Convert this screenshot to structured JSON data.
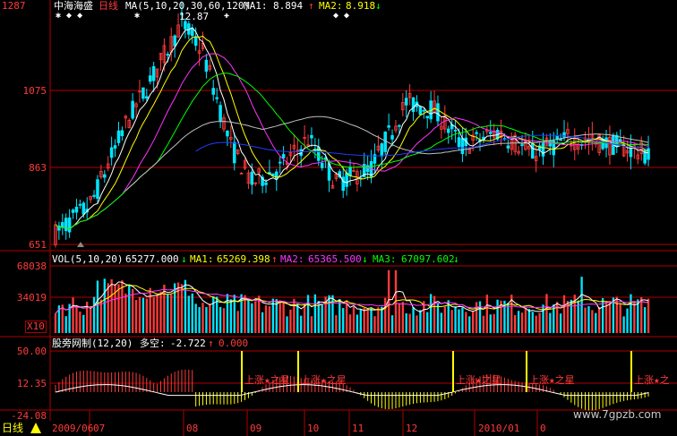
{
  "app": {
    "stock_name": "中海海盛",
    "period": "日线",
    "watermark": "www.7gpzb.com"
  },
  "price_header": {
    "ma_params": "MA(5,10,20,30,60,120)",
    "ma1_label": "MA1:",
    "ma1_value": "8.894",
    "ma2_label": "MA2:",
    "ma2_value": "8.918",
    "high_note": "12.87"
  },
  "price_axis": [
    "1287",
    "1075",
    "863",
    "651"
  ],
  "vol_header": {
    "params": "VOL(5,10,20)",
    "vol_value": "65277.000",
    "ma1_label": "MA1:",
    "ma1_value": "65269.398",
    "ma2_label": "MA2:",
    "ma2_value": "65365.500",
    "ma3_label": "MA3:",
    "ma3_value": "67097.602"
  },
  "vol_axis": [
    "68038",
    "34019",
    "X10"
  ],
  "ind_header": {
    "name": "股旁网制(12,20)",
    "label": "多空:",
    "value1": "-2.722",
    "value2": "0.000"
  },
  "ind_axis": [
    "50.00",
    "12.35",
    "-24.08"
  ],
  "markers": [
    "上涨★之星",
    "上涨★之星",
    "上涨★之星",
    "上涨★之星",
    "上涨★之星",
    "上涨★之"
  ],
  "date_axis": {
    "mode_label": "日线",
    "labels": [
      "2009/06",
      "07",
      "08",
      "09",
      "10",
      "11",
      "12",
      "2010/01",
      "0"
    ]
  },
  "colors": {
    "up": "#ff3b3b",
    "down": "#00e5ff",
    "ma5": "#ffffff",
    "ma10": "#ffff00",
    "ma20": "#ff33ff",
    "ma30": "#00ff00",
    "ma60": "#c0c0c0",
    "ma120": "#1e3cff"
  },
  "chart_data": {
    "type": "line",
    "title": "中海海盛",
    "series": [
      {
        "name": "MA1",
        "values": [
          6.6,
          6.8,
          7.1,
          7.6,
          8.4,
          9.2,
          9.8,
          10.2,
          10.6,
          11.0,
          11.6,
          12.2,
          12.4,
          12.1,
          11.5,
          10.6,
          9.6,
          8.9,
          8.4,
          8.6,
          9.0,
          8.7,
          8.4,
          8.6,
          8.9,
          9.2,
          9.7,
          10.2,
          10.4,
          10.1,
          9.7,
          9.3,
          9.0,
          8.9,
          9.1,
          9.3,
          9.2,
          9.4,
          9.1,
          9.0,
          9.0,
          8.9
        ]
      },
      {
        "name": "MA2",
        "values": [
          6.7,
          6.8,
          7.0,
          7.4,
          8.0,
          8.7,
          9.3,
          9.8,
          10.2,
          10.6,
          11.1,
          11.6,
          11.9,
          11.8,
          11.4,
          10.8,
          10.1,
          9.4,
          8.9,
          8.8,
          8.9,
          8.8,
          8.6,
          8.6,
          8.8,
          9.0,
          9.4,
          9.8,
          10.1,
          10.0,
          9.8,
          9.5,
          9.2,
          9.1,
          9.1,
          9.2,
          9.2,
          9.3,
          9.2,
          9.1,
          9.0,
          8.9
        ]
      }
    ],
    "ylim": [
      6.51,
      12.87
    ]
  }
}
